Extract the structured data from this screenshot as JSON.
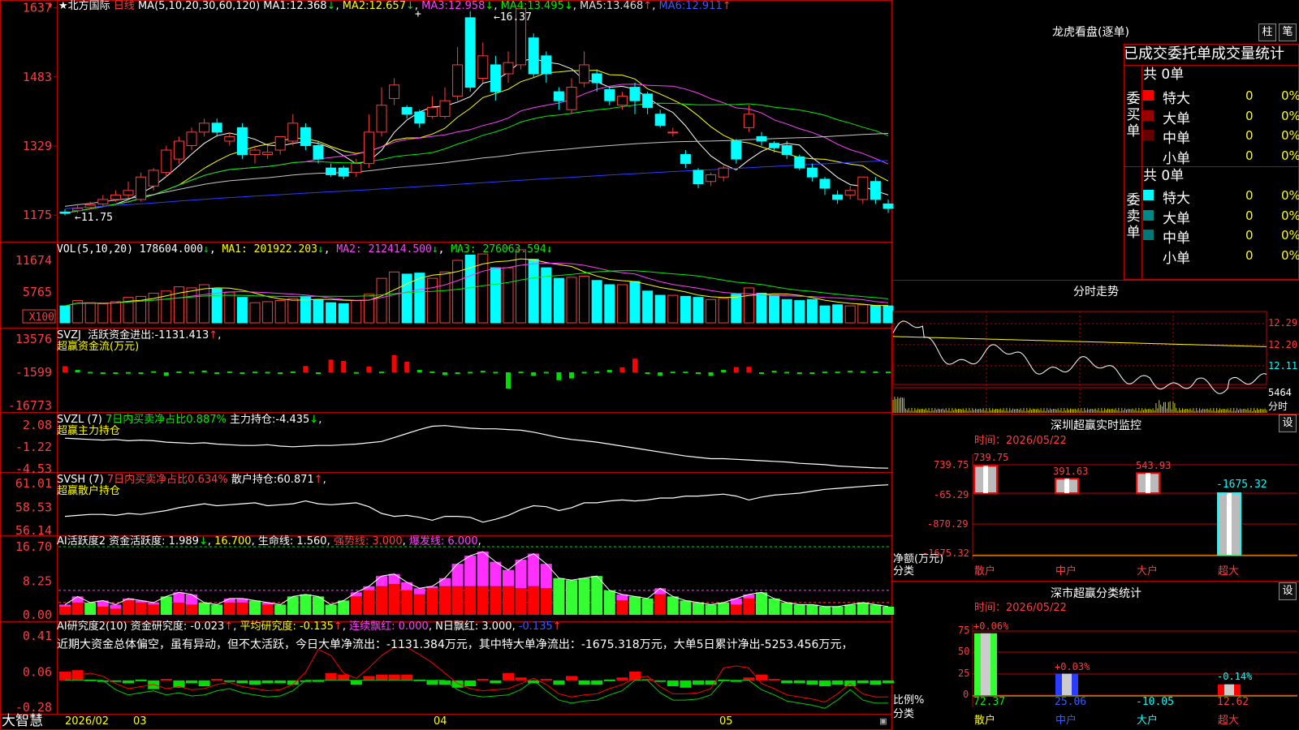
{
  "colors": {
    "up": "#ff3c3c",
    "down": "#00ffff",
    "ma1": "#ffffff",
    "ma2": "#ffff00",
    "ma3": "#ff40ff",
    "ma4": "#00ee00",
    "ma5": "#c8c8c8",
    "ma6": "#2a3cff",
    "grid": "#c00000"
  },
  "kline": {
    "name": "北方国际",
    "period": "日线",
    "ma_label": "MA(5,10,20,30,60,120)",
    "ma": [
      {
        "k": "MA1:",
        "v": "12.368",
        "a": "↓"
      },
      {
        "k": "MA2:",
        "v": "12.657",
        "a": "↓"
      },
      {
        "k": "MA3:",
        "v": "12.958",
        "a": "↓"
      },
      {
        "k": "MA4:",
        "v": "13.495",
        "a": "↓"
      },
      {
        "k": "MA5:",
        "v": "13.468",
        "a": "↑"
      },
      {
        "k": "MA6:",
        "v": "12.911",
        "a": "↑"
      }
    ],
    "high_label": "16.37",
    "low_label": "11.75",
    "y_ticks": [
      "1637",
      "1483",
      "1329",
      "1175"
    ],
    "candles": [
      {
        "o": 11.82,
        "c": 11.79,
        "h": 11.88,
        "l": 11.75
      },
      {
        "o": 11.85,
        "c": 11.9,
        "h": 12.0,
        "l": 11.8
      },
      {
        "o": 11.92,
        "c": 11.98,
        "h": 12.05,
        "l": 11.88
      },
      {
        "o": 12.0,
        "c": 12.1,
        "h": 12.2,
        "l": 11.95
      },
      {
        "o": 12.1,
        "c": 12.2,
        "h": 12.3,
        "l": 12.05
      },
      {
        "o": 12.2,
        "c": 12.3,
        "h": 12.5,
        "l": 12.1
      },
      {
        "o": 12.1,
        "c": 12.6,
        "h": 12.7,
        "l": 12.05
      },
      {
        "o": 12.4,
        "c": 12.75,
        "h": 12.8,
        "l": 12.3
      },
      {
        "o": 12.7,
        "c": 13.2,
        "h": 13.3,
        "l": 12.6
      },
      {
        "o": 13.0,
        "c": 13.4,
        "h": 13.5,
        "l": 12.9
      },
      {
        "o": 13.3,
        "c": 13.6,
        "h": 13.7,
        "l": 13.2
      },
      {
        "o": 13.6,
        "c": 13.8,
        "h": 13.9,
        "l": 13.5
      },
      {
        "o": 13.8,
        "c": 13.6,
        "h": 13.9,
        "l": 13.5
      },
      {
        "o": 13.4,
        "c": 13.5,
        "h": 13.6,
        "l": 13.3
      },
      {
        "o": 13.7,
        "c": 13.1,
        "h": 13.8,
        "l": 13.0
      },
      {
        "o": 13.1,
        "c": 13.2,
        "h": 13.3,
        "l": 12.9
      },
      {
        "o": 13.1,
        "c": 13.15,
        "h": 13.3,
        "l": 13.0
      },
      {
        "o": 13.2,
        "c": 13.5,
        "h": 13.5,
        "l": 13.1
      },
      {
        "o": 13.4,
        "c": 13.8,
        "h": 14.0,
        "l": 13.3
      },
      {
        "o": 13.7,
        "c": 13.3,
        "h": 13.8,
        "l": 13.2
      },
      {
        "o": 13.3,
        "c": 13.0,
        "h": 13.4,
        "l": 12.9
      },
      {
        "o": 12.8,
        "c": 12.65,
        "h": 12.9,
        "l": 12.6
      },
      {
        "o": 12.8,
        "c": 12.62,
        "h": 12.85,
        "l": 12.55
      },
      {
        "o": 12.7,
        "c": 12.9,
        "h": 13.0,
        "l": 12.6
      },
      {
        "o": 12.9,
        "c": 13.6,
        "h": 14.0,
        "l": 12.8
      },
      {
        "o": 13.6,
        "c": 14.2,
        "h": 14.6,
        "l": 13.5
      },
      {
        "o": 14.35,
        "c": 14.65,
        "h": 14.8,
        "l": 14.2
      },
      {
        "o": 14.15,
        "c": 14.0,
        "h": 14.2,
        "l": 13.9
      },
      {
        "o": 14.05,
        "c": 13.8,
        "h": 14.1,
        "l": 13.7
      },
      {
        "o": 13.95,
        "c": 14.15,
        "h": 14.4,
        "l": 13.9
      },
      {
        "o": 13.95,
        "c": 14.3,
        "h": 14.6,
        "l": 13.9
      },
      {
        "o": 14.4,
        "c": 15.1,
        "h": 15.5,
        "l": 14.3
      },
      {
        "o": 16.15,
        "c": 14.6,
        "h": 16.3,
        "l": 14.5
      },
      {
        "o": 14.8,
        "c": 15.3,
        "h": 15.6,
        "l": 14.7
      },
      {
        "o": 15.1,
        "c": 14.5,
        "h": 15.3,
        "l": 14.3
      },
      {
        "o": 14.9,
        "c": 15.15,
        "h": 15.4,
        "l": 14.7
      },
      {
        "o": 15.1,
        "c": 16.35,
        "h": 16.37,
        "l": 15.0
      },
      {
        "o": 15.7,
        "c": 14.9,
        "h": 15.8,
        "l": 14.8
      },
      {
        "o": 15.3,
        "c": 14.9,
        "h": 15.4,
        "l": 14.7
      },
      {
        "o": 14.5,
        "c": 14.3,
        "h": 14.6,
        "l": 14.1
      },
      {
        "o": 14.1,
        "c": 14.6,
        "h": 14.8,
        "l": 14.0
      },
      {
        "o": 14.7,
        "c": 15.1,
        "h": 15.4,
        "l": 14.6
      },
      {
        "o": 14.9,
        "c": 14.7,
        "h": 15.0,
        "l": 14.5
      },
      {
        "o": 14.55,
        "c": 14.3,
        "h": 14.6,
        "l": 14.2
      },
      {
        "o": 14.2,
        "c": 14.4,
        "h": 14.5,
        "l": 14.1
      },
      {
        "o": 14.6,
        "c": 14.3,
        "h": 14.7,
        "l": 14.0
      },
      {
        "o": 14.45,
        "c": 14.15,
        "h": 14.5,
        "l": 14.0
      },
      {
        "o": 14.0,
        "c": 13.75,
        "h": 14.1,
        "l": 13.7
      },
      {
        "o": 13.6,
        "c": 13.6,
        "h": 13.7,
        "l": 13.5
      },
      {
        "o": 13.1,
        "c": 12.9,
        "h": 13.2,
        "l": 12.8
      },
      {
        "o": 12.75,
        "c": 12.45,
        "h": 12.8,
        "l": 12.35
      },
      {
        "o": 12.5,
        "c": 12.65,
        "h": 12.7,
        "l": 12.4
      },
      {
        "o": 12.6,
        "c": 12.8,
        "h": 12.85,
        "l": 12.5
      },
      {
        "o": 13.4,
        "c": 13.0,
        "h": 13.45,
        "l": 12.9
      },
      {
        "o": 13.7,
        "c": 14.0,
        "h": 14.2,
        "l": 13.6
      },
      {
        "o": 13.5,
        "c": 13.4,
        "h": 13.6,
        "l": 13.3
      },
      {
        "o": 13.35,
        "c": 13.25,
        "h": 13.4,
        "l": 13.15
      },
      {
        "o": 13.3,
        "c": 13.1,
        "h": 13.4,
        "l": 13.0
      },
      {
        "o": 13.05,
        "c": 12.8,
        "h": 13.1,
        "l": 12.75
      },
      {
        "o": 12.8,
        "c": 12.6,
        "h": 12.9,
        "l": 12.5
      },
      {
        "o": 12.55,
        "c": 12.35,
        "h": 12.6,
        "l": 12.2
      },
      {
        "o": 12.2,
        "c": 12.1,
        "h": 12.3,
        "l": 12.0
      },
      {
        "o": 12.2,
        "c": 12.3,
        "h": 12.4,
        "l": 12.1
      },
      {
        "o": 12.1,
        "c": 12.6,
        "h": 12.6,
        "l": 12.0
      },
      {
        "o": 12.5,
        "c": 12.1,
        "h": 12.6,
        "l": 12.0
      },
      {
        "o": 12.0,
        "c": 11.9,
        "h": 12.1,
        "l": 11.8
      }
    ]
  },
  "vol": {
    "label": "VOL(5,10,20)",
    "value": "178604.000",
    "value_arrow": "↓",
    "ma": [
      {
        "k": "MA1:",
        "v": "201922.203",
        "a": "↓"
      },
      {
        "k": "MA2:",
        "v": "212414.500",
        "a": "↓"
      },
      {
        "k": "MA3:",
        "v": "276063.594",
        "a": "↓"
      }
    ],
    "y_ticks": [
      "11674",
      "5765"
    ],
    "unit": "X100",
    "values": [
      1.6,
      2.1,
      1.9,
      1.8,
      2.0,
      2.4,
      2.5,
      2.8,
      3.0,
      3.4,
      3.3,
      3.6,
      3.2,
      2.9,
      2.4,
      1.9,
      2.0,
      2.1,
      2.3,
      2.5,
      2.2,
      1.9,
      1.8,
      2.1,
      2.7,
      4.2,
      4.8,
      4.6,
      4.7,
      4.2,
      4.8,
      5.9,
      6.4,
      6.5,
      5.2,
      5.2,
      6.9,
      6.0,
      5.2,
      4.2,
      4.3,
      4.4,
      4.0,
      3.6,
      3.6,
      3.9,
      3.0,
      2.6,
      2.6,
      2.5,
      2.4,
      2.2,
      2.3,
      2.7,
      3.3,
      2.8,
      2.6,
      2.2,
      2.1,
      2.2,
      1.6,
      1.7,
      1.6,
      1.7,
      1.6,
      1.6
    ]
  },
  "svzj": {
    "name": "SVZJ",
    "label": "活跃资金进出:",
    "value": "-1131.413",
    "arrow": "↑",
    "sub": "超赢资金流(万元)",
    "y_ticks": [
      "13576",
      "-1599",
      "-16773"
    ],
    "values": [
      1200,
      -500,
      -1400,
      -1800,
      -1600,
      -1500,
      -1900,
      -1100,
      -3200,
      -1200,
      -1400,
      -800,
      -1600,
      -1200,
      -1800,
      -1300,
      -1400,
      -1600,
      -1200,
      1300,
      -1600,
      4200,
      3600,
      -1500,
      1000,
      -1300,
      6200,
      3200,
      -500,
      -1200,
      -2900,
      -1600,
      -1400,
      -900,
      -1400,
      -9000,
      -1300,
      -3200,
      -1400,
      -5200,
      -4400,
      -1400,
      -1300,
      -500,
      700,
      4600,
      -1700,
      -3200,
      -1300,
      -1300,
      -1600,
      -3200,
      -500,
      800,
      900,
      -1700,
      -900,
      -1400,
      -1600,
      -1600,
      -1300,
      -1300,
      -900,
      -1100,
      -1200,
      -1300
    ]
  },
  "svzl": {
    "name": "SVZL",
    "period": "(7)",
    "desc": "7日内买卖净占比0.887%",
    "label": "主力持仓:",
    "value": "-4.435",
    "arrow": "↓",
    "sub": "超赢主力持仓",
    "y_ticks": [
      "2.08",
      "-1.22",
      "-4.53"
    ],
    "values": [
      0.1,
      0.0,
      -0.1,
      -0.2,
      -0.1,
      -0.3,
      -0.2,
      -0.3,
      -0.5,
      -0.6,
      -0.7,
      -0.6,
      -0.8,
      -0.9,
      -1.0,
      -1.0,
      -0.9,
      -1.1,
      -1.2,
      -1.1,
      -1.0,
      -1.0,
      -0.9,
      -0.8,
      -0.6,
      -0.4,
      0.2,
      0.8,
      1.4,
      1.9,
      2.0,
      1.8,
      1.6,
      1.5,
      1.5,
      1.4,
      1.3,
      1.0,
      0.6,
      0.2,
      -0.1,
      -0.3,
      -0.5,
      -0.8,
      -1.1,
      -1.4,
      -1.7,
      -2.0,
      -2.3,
      -2.6,
      -2.8,
      -3.0,
      -3.0,
      -3.1,
      -3.2,
      -3.3,
      -3.4,
      -3.5,
      -3.7,
      -3.8,
      -3.9,
      -4.1,
      -4.2,
      -4.3,
      -4.4,
      -4.43
    ]
  },
  "svsh": {
    "name": "SVSH",
    "period": "(7)",
    "desc": "7日内买卖净占比0.634%",
    "label": "散户持仓:",
    "value": "60.871",
    "arrow": "↑",
    "sub": "超赢散户持仓",
    "y_ticks": [
      "61.01",
      "58.53",
      "56.14"
    ],
    "values": [
      57.6,
      57.7,
      57.8,
      57.8,
      57.7,
      57.9,
      57.8,
      58.0,
      58.2,
      58.5,
      58.7,
      58.9,
      58.7,
      58.8,
      58.9,
      59.0,
      58.7,
      58.8,
      58.9,
      59.2,
      58.9,
      58.8,
      58.9,
      59.0,
      58.6,
      57.9,
      57.6,
      57.7,
      57.5,
      57.2,
      57.6,
      57.6,
      57.5,
      57.0,
      57.3,
      57.7,
      58.3,
      58.7,
      58.6,
      58.2,
      58.5,
      59.0,
      59.0,
      59.2,
      59.3,
      59.2,
      59.3,
      59.5,
      59.5,
      59.7,
      59.7,
      59.8,
      59.9,
      59.7,
      59.3,
      59.6,
      59.8,
      59.9,
      60.0,
      60.2,
      60.4,
      60.5,
      60.6,
      60.7,
      60.8,
      60.87
    ]
  },
  "ai1": {
    "name": "AI活跃度2",
    "label": "资金活跃度:",
    "value": "1.989",
    "arrow": "↓",
    "v2": "16.700",
    "l3": "生命线:",
    "v3": "1.560",
    "l4": "强势线:",
    "v4": "3.000",
    "l5": "爆发线:",
    "v5": "6.000",
    "y_ticks": [
      "16.70",
      "8.25",
      "0.00"
    ],
    "values": [
      2.5,
      4.5,
      3.0,
      3.5,
      2.5,
      4.0,
      3.5,
      3.0,
      4.5,
      5.5,
      5.0,
      3.0,
      2.5,
      4.0,
      4.0,
      3.5,
      3.0,
      2.5,
      4.5,
      5.0,
      4.5,
      2.5,
      3.5,
      5.5,
      7.0,
      9.5,
      10.0,
      8.0,
      6.5,
      7.0,
      9.0,
      12.5,
      14.5,
      15.5,
      13.0,
      11.0,
      13.5,
      15.0,
      12.5,
      9.0,
      8.5,
      9.0,
      9.5,
      6.0,
      5.0,
      4.5,
      4.0,
      6.5,
      4.5,
      3.5,
      3.0,
      2.5,
      3.0,
      4.0,
      5.0,
      5.5,
      4.0,
      3.0,
      2.5,
      2.5,
      2.0,
      2.0,
      2.5,
      3.0,
      2.5,
      2.0
    ],
    "red": [
      2.0,
      3.0,
      0,
      2.0,
      1.5,
      3.5,
      3.0,
      2.5,
      0,
      3.0,
      2.5,
      0,
      0,
      3.0,
      3.0,
      0,
      2.5,
      0,
      0,
      0,
      0,
      0,
      0,
      4.5,
      6.0,
      7.0,
      7.5,
      6.0,
      5.0,
      6.5,
      7.0,
      7.0,
      7.0,
      7.0,
      7.0,
      7.0,
      6.5,
      7.0,
      6.5,
      0,
      0,
      0,
      0,
      0,
      3.5,
      0,
      0,
      5.0,
      0,
      0,
      0,
      0,
      0,
      2.5,
      4.0,
      0,
      0,
      0,
      0,
      0,
      0,
      0,
      0,
      0,
      0,
      0
    ]
  },
  "ai2": {
    "name": "AI研究度2(10)",
    "label": "资金研究度:",
    "value": "-0.023",
    "arrow": "↑",
    "l2": "平均研究度:",
    "v2": "-0.135",
    "a2": "↑",
    "l3": "连续飘红:",
    "v3": "0.000",
    "l4": "N日飘红:",
    "v4": "3.000",
    "v5": "-0.135",
    "a5": "↑",
    "y_ticks": [
      "0.41",
      "0.06",
      "-0.28"
    ],
    "comment": "近期大资金总体偏空，虽有异动，但不太活跃，今日大单净流出：-1131.384万元，其中特大单净流出：-1675.318万元，大单5日累计净出-5253.456万元，",
    "bars": [
      0.06,
      0.07,
      0,
      -0.01,
      -0.01,
      -0.02,
      0,
      -0.06,
      0.01,
      -0.05,
      -0.02,
      -0.04,
      0.01,
      -0.01,
      -0.02,
      -0.03,
      -0.02,
      -0.02,
      -0.03,
      -0.01,
      -0.01,
      0.05,
      0.04,
      -0.03,
      0.03,
      0.04,
      0.04,
      0.04,
      0,
      -0.03,
      -0.03,
      -0.05,
      -0.04,
      0.01,
      -0.02,
      0.05,
      0.02,
      -0.02,
      0.01,
      -0.03,
      0.03,
      -0.03,
      -0.03,
      0,
      0.02,
      0.06,
      0.01,
      -0.01,
      -0.04,
      -0.05,
      -0.03,
      -0.03,
      0,
      -0.01,
      0.02,
      0.04,
      0.01,
      -0.02,
      -0.02,
      -0.03,
      -0.04,
      -0.03,
      -0.04,
      -0.02,
      -0.03,
      -0.02
    ],
    "line": [
      0.0,
      0.03,
      0.05,
      0.02,
      -0.05,
      -0.1,
      -0.08,
      -0.06,
      -0.1,
      -0.08,
      -0.11,
      -0.1,
      -0.06,
      -0.04,
      -0.08,
      -0.1,
      -0.12,
      -0.11,
      -0.06,
      0.06,
      0.28,
      0.22,
      0.05,
      0.0,
      0.1,
      0.22,
      0.3,
      0.3,
      0.23,
      0.15,
      0.05,
      -0.05,
      -0.1,
      -0.12,
      -0.11,
      -0.1,
      -0.05,
      0.0,
      -0.06,
      -0.15,
      -0.18,
      -0.16,
      -0.15,
      -0.1,
      -0.06,
      0.0,
      0.02,
      -0.08,
      -0.15,
      -0.15,
      -0.14,
      -0.1,
      0.1,
      0.12,
      0.1,
      -0.05,
      -0.1,
      -0.16,
      -0.18,
      -0.2,
      -0.23,
      -0.15,
      -0.05,
      -0.15,
      -0.18,
      -0.18
    ]
  },
  "xaxis": {
    "labels": [
      "2026/02",
      "03",
      "04",
      "05"
    ]
  },
  "brand": "大智慧",
  "lhb": {
    "title": "龙虎看盘(逐单)",
    "btn_bar": "柱",
    "btn_pen": "笔",
    "header": "已成交委托单成交量统计",
    "buy_label": "委买单",
    "sell_label": "委卖单",
    "buy_total": "共 0单",
    "sell_total": "共 0单",
    "buy_rows": [
      {
        "name": "特大",
        "count": "0",
        "pct": "0%",
        "color": "#ff0000"
      },
      {
        "name": "大单",
        "count": "0",
        "pct": "0%",
        "color": "#990000"
      },
      {
        "name": "中单",
        "count": "0",
        "pct": "0%",
        "color": "#660000"
      },
      {
        "name": "小单",
        "count": "0",
        "pct": "0%",
        "color": "#000000"
      }
    ],
    "sell_rows": [
      {
        "name": "特大",
        "count": "0",
        "pct": "0%",
        "color": "#00ffff"
      },
      {
        "name": "大单",
        "count": "0",
        "pct": "0%",
        "color": "#008888"
      },
      {
        "name": "中单",
        "count": "0",
        "pct": "0%",
        "color": "#007777"
      },
      {
        "name": "小单",
        "count": "0",
        "pct": "0%",
        "color": "#000000"
      }
    ]
  },
  "intraday": {
    "title": "分时走势",
    "prices": [
      "12.29",
      "12.20",
      "12.11"
    ],
    "vol_value": "5464",
    "vol_label": "分时"
  },
  "monitor": {
    "title": "深圳超赢实时监控",
    "btn": "设",
    "time": "时间：2026/05/22",
    "y_ticks": [
      "739.75",
      "-65.29",
      "-870.29",
      "-1675.32"
    ],
    "ylabel1": "净额(万元)",
    "ylabel2": "分类",
    "categories": [
      "散户",
      "中户",
      "大户",
      "超大"
    ],
    "values": [
      739.75,
      391.63,
      543.93,
      -1675.32
    ],
    "labels": [
      "739.75",
      "391.63",
      "543.93",
      "-1675.32"
    ]
  },
  "stats": {
    "title": "深市超赢分类统计",
    "btn": "设",
    "time": "时间：2026/05/22",
    "y_ticks": [
      "75",
      "50",
      "25",
      "0"
    ],
    "ylabel1": "比例%",
    "ylabel2": "分类",
    "categories": [
      "散户",
      "中户",
      "大户",
      "超大"
    ],
    "values": [
      72.37,
      25.06,
      -10.05,
      12.62
    ],
    "value_labels": [
      "72.37",
      "25.06",
      "-10.05",
      "12.62"
    ],
    "changes": [
      "+0.06%",
      "+0.03%",
      "",
      "-0.14%"
    ]
  }
}
